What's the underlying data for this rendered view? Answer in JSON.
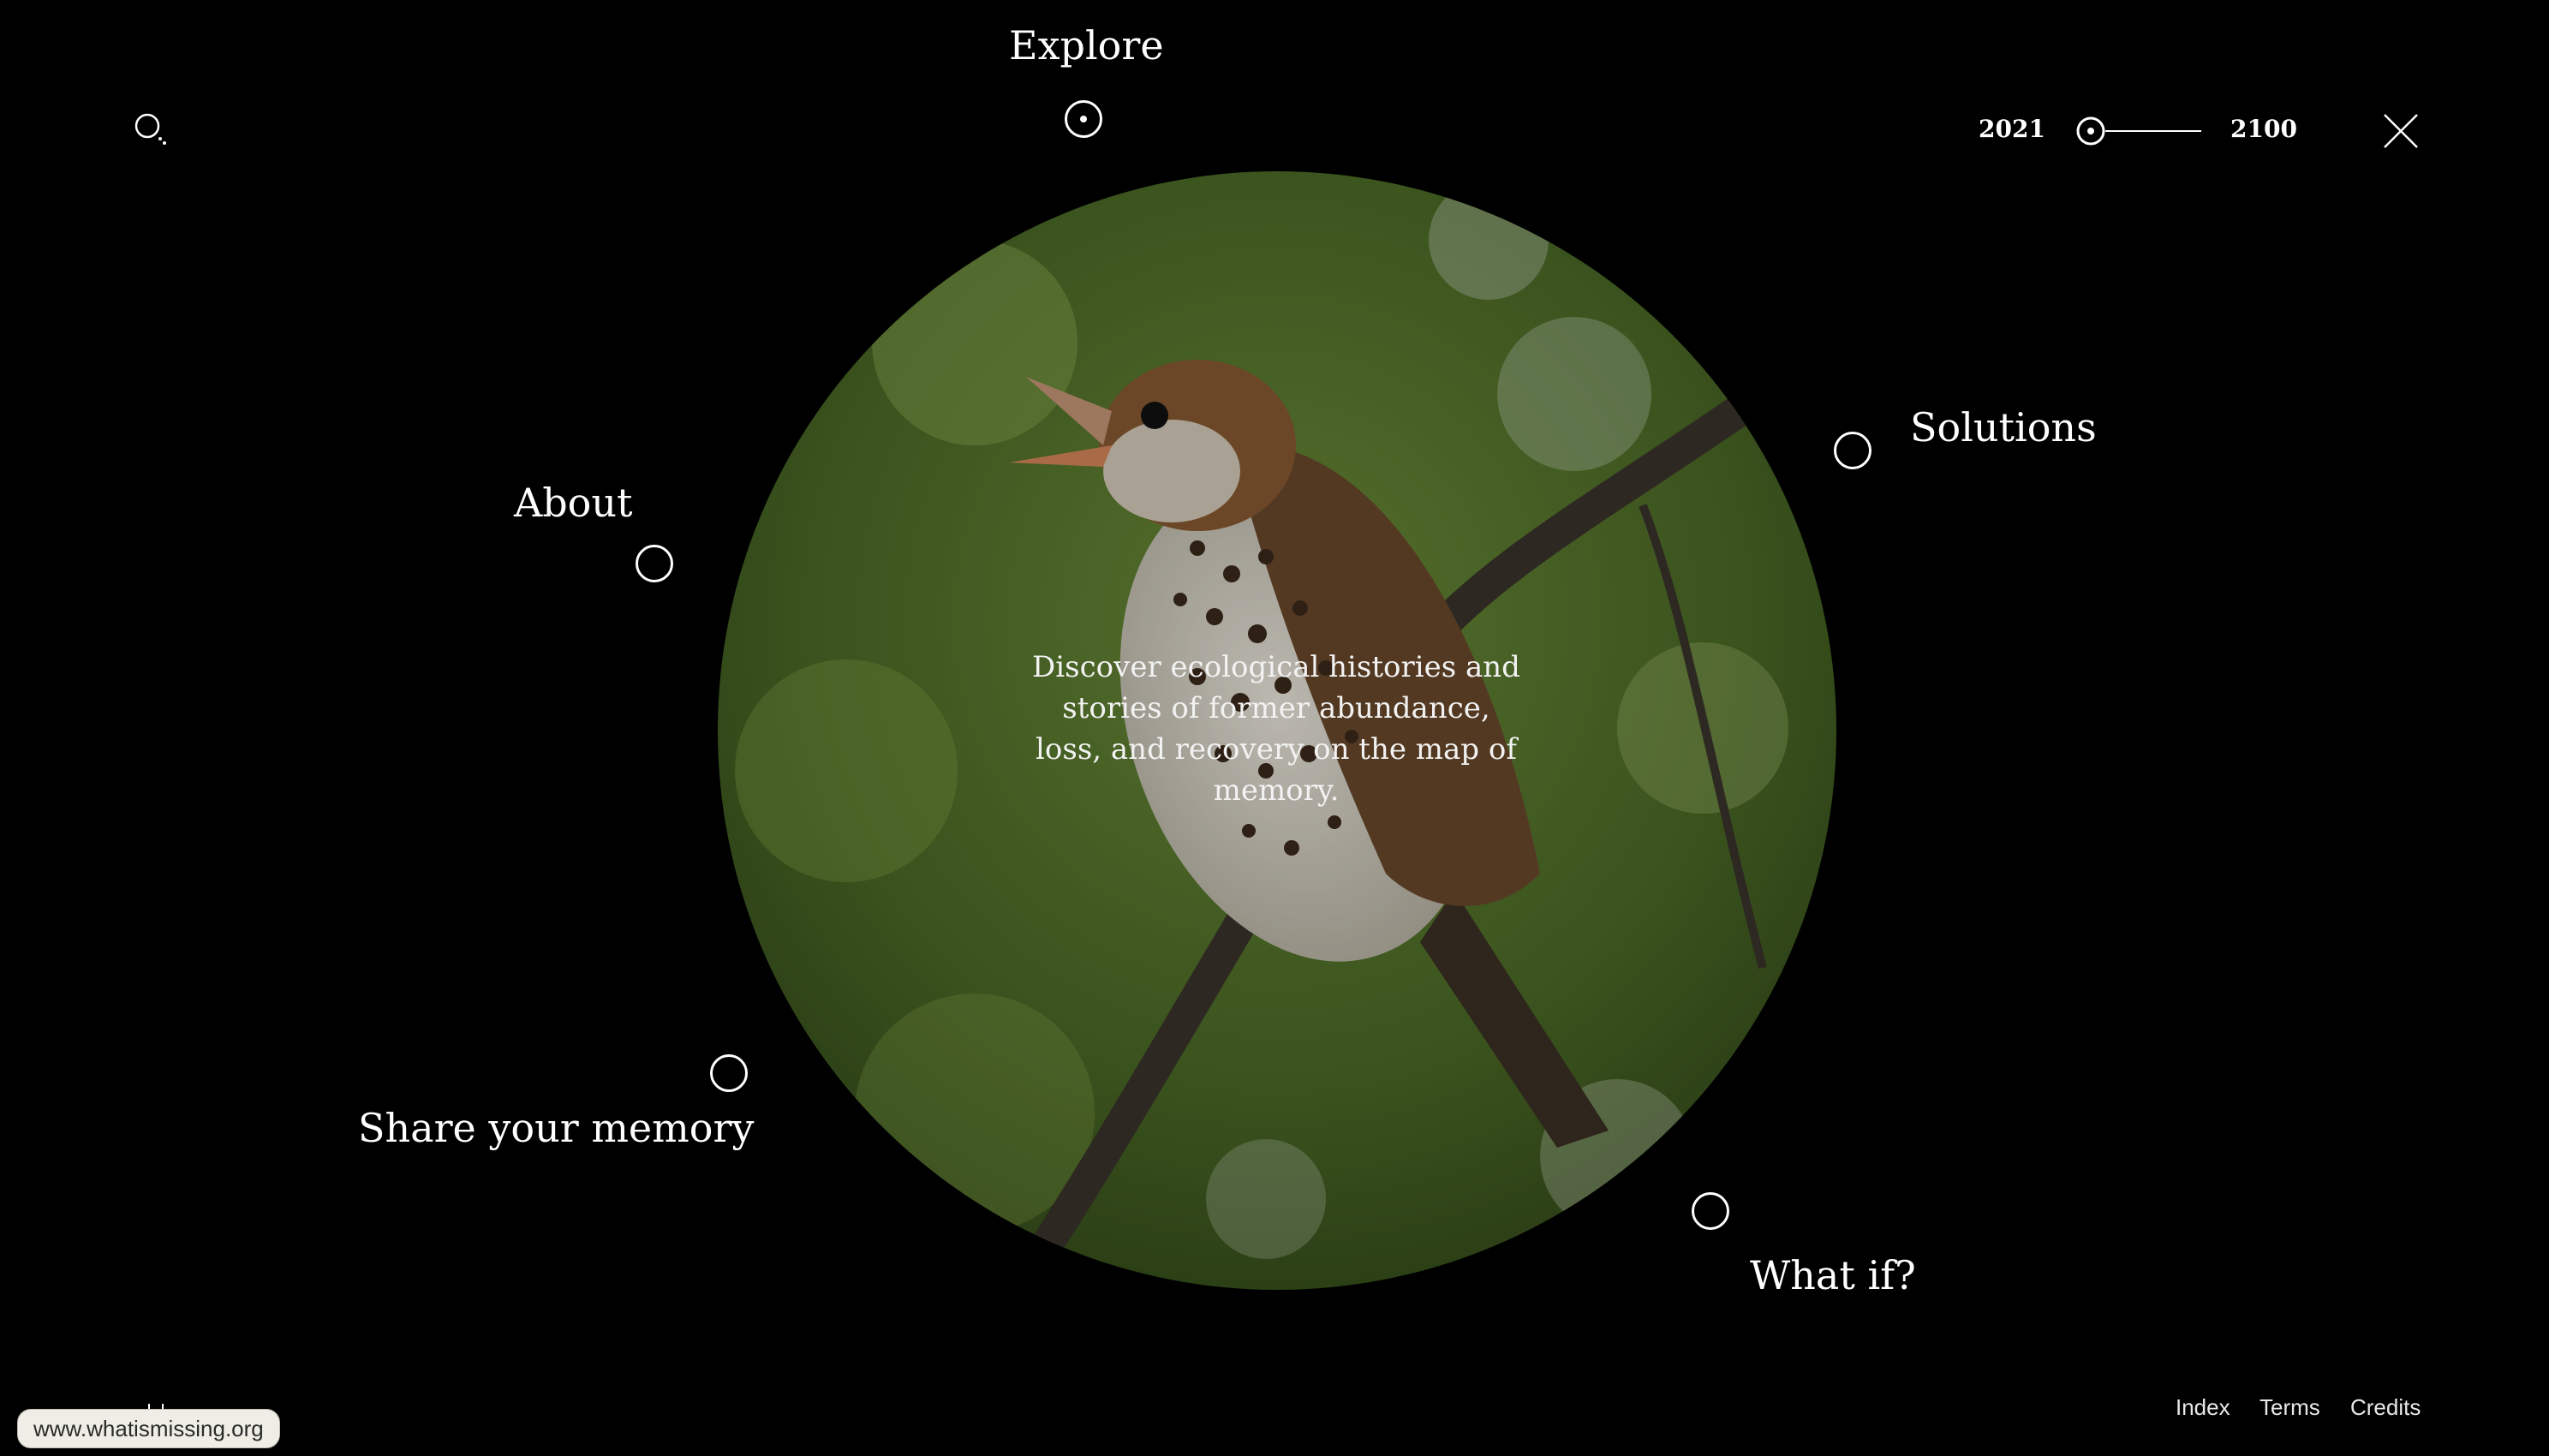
{
  "header": {
    "search_icon": "search-icon",
    "timeline": {
      "start_year": "2021",
      "end_year": "2100",
      "value": 0
    },
    "close_icon": "close-icon"
  },
  "hero": {
    "image": "wood-thrush-bird-on-branch",
    "intro_text": "Discover ecological histories and stories of former abundance, loss, and recovery on the map of memory."
  },
  "nav": {
    "explore": "Explore",
    "about": "About",
    "solutions": "Solutions",
    "share": "Share your memory",
    "whatif": "What if?"
  },
  "footer": {
    "index": "Index",
    "terms": "Terms",
    "credits": "Credits",
    "url": "www.whatismissing.org"
  },
  "colors": {
    "background": "#000000",
    "foreground": "#ffffff"
  }
}
